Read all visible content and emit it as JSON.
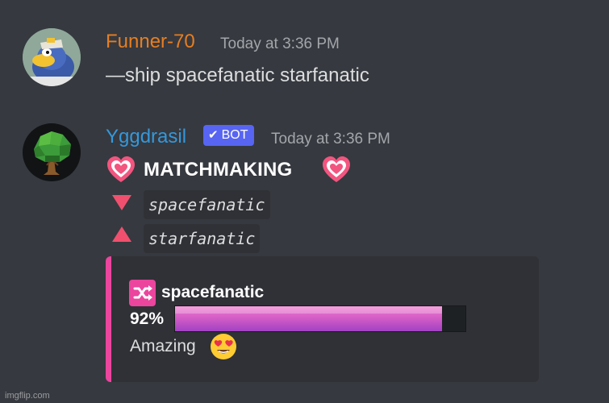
{
  "messages": [
    {
      "username": "Funner-70",
      "username_color": "#e67e22",
      "timestamp": "Today at 3:36 PM",
      "content": "—ship spacefanatic starfanatic",
      "avatar_icon": "penguin-avatar"
    },
    {
      "username": "Yggdrasil",
      "username_color": "#3498db",
      "bot_tag": "BOT",
      "timestamp": "Today at 3:36 PM",
      "avatar_icon": "tree-avatar",
      "title": "MATCHMAKING",
      "users": [
        {
          "direction": "down",
          "name": "spacefanatic"
        },
        {
          "direction": "up",
          "name": "starfanatic"
        }
      ],
      "embed": {
        "accent_color": "#eb459e",
        "title": "spacefanatic",
        "percent_label": "92%",
        "percent": 92,
        "verdict": "Amazing",
        "verdict_emoji": "heart-eyes-emoji"
      }
    }
  ],
  "watermark": "imgflip.com"
}
